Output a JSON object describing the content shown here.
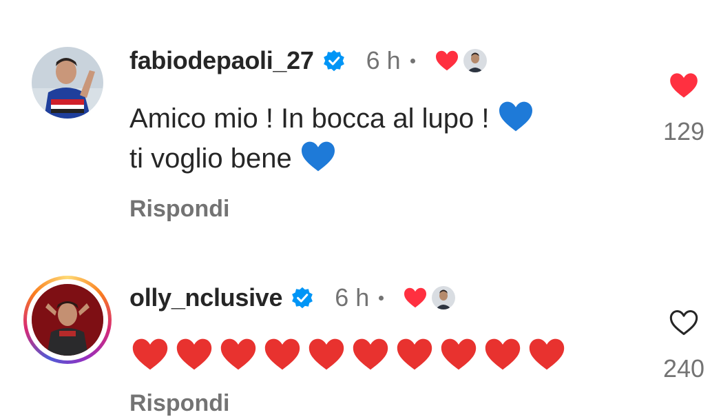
{
  "comments": [
    {
      "username": "fabiodepaoli_27",
      "verified": true,
      "time": "6 h",
      "liked_by_author": true,
      "text_line1": "Amico mio ! In bocca al lupo !",
      "text_line2": "ti voglio bene",
      "emoji": "blue-heart",
      "reply_label": "Rispondi",
      "like_count": "129",
      "liked": true,
      "has_story_ring": false
    },
    {
      "username": "olly_nclusive",
      "verified": true,
      "time": "6 h",
      "liked_by_author": true,
      "emoji": "red-heart",
      "emoji_count": 10,
      "reply_label": "Rispondi",
      "like_count": "240",
      "liked": false,
      "has_story_ring": true
    }
  ],
  "colors": {
    "text": "#262626",
    "secondary": "#737373",
    "verified_blue": "#0095f6",
    "like_red": "#ff3040",
    "blue_heart": "#1e7ad8"
  }
}
